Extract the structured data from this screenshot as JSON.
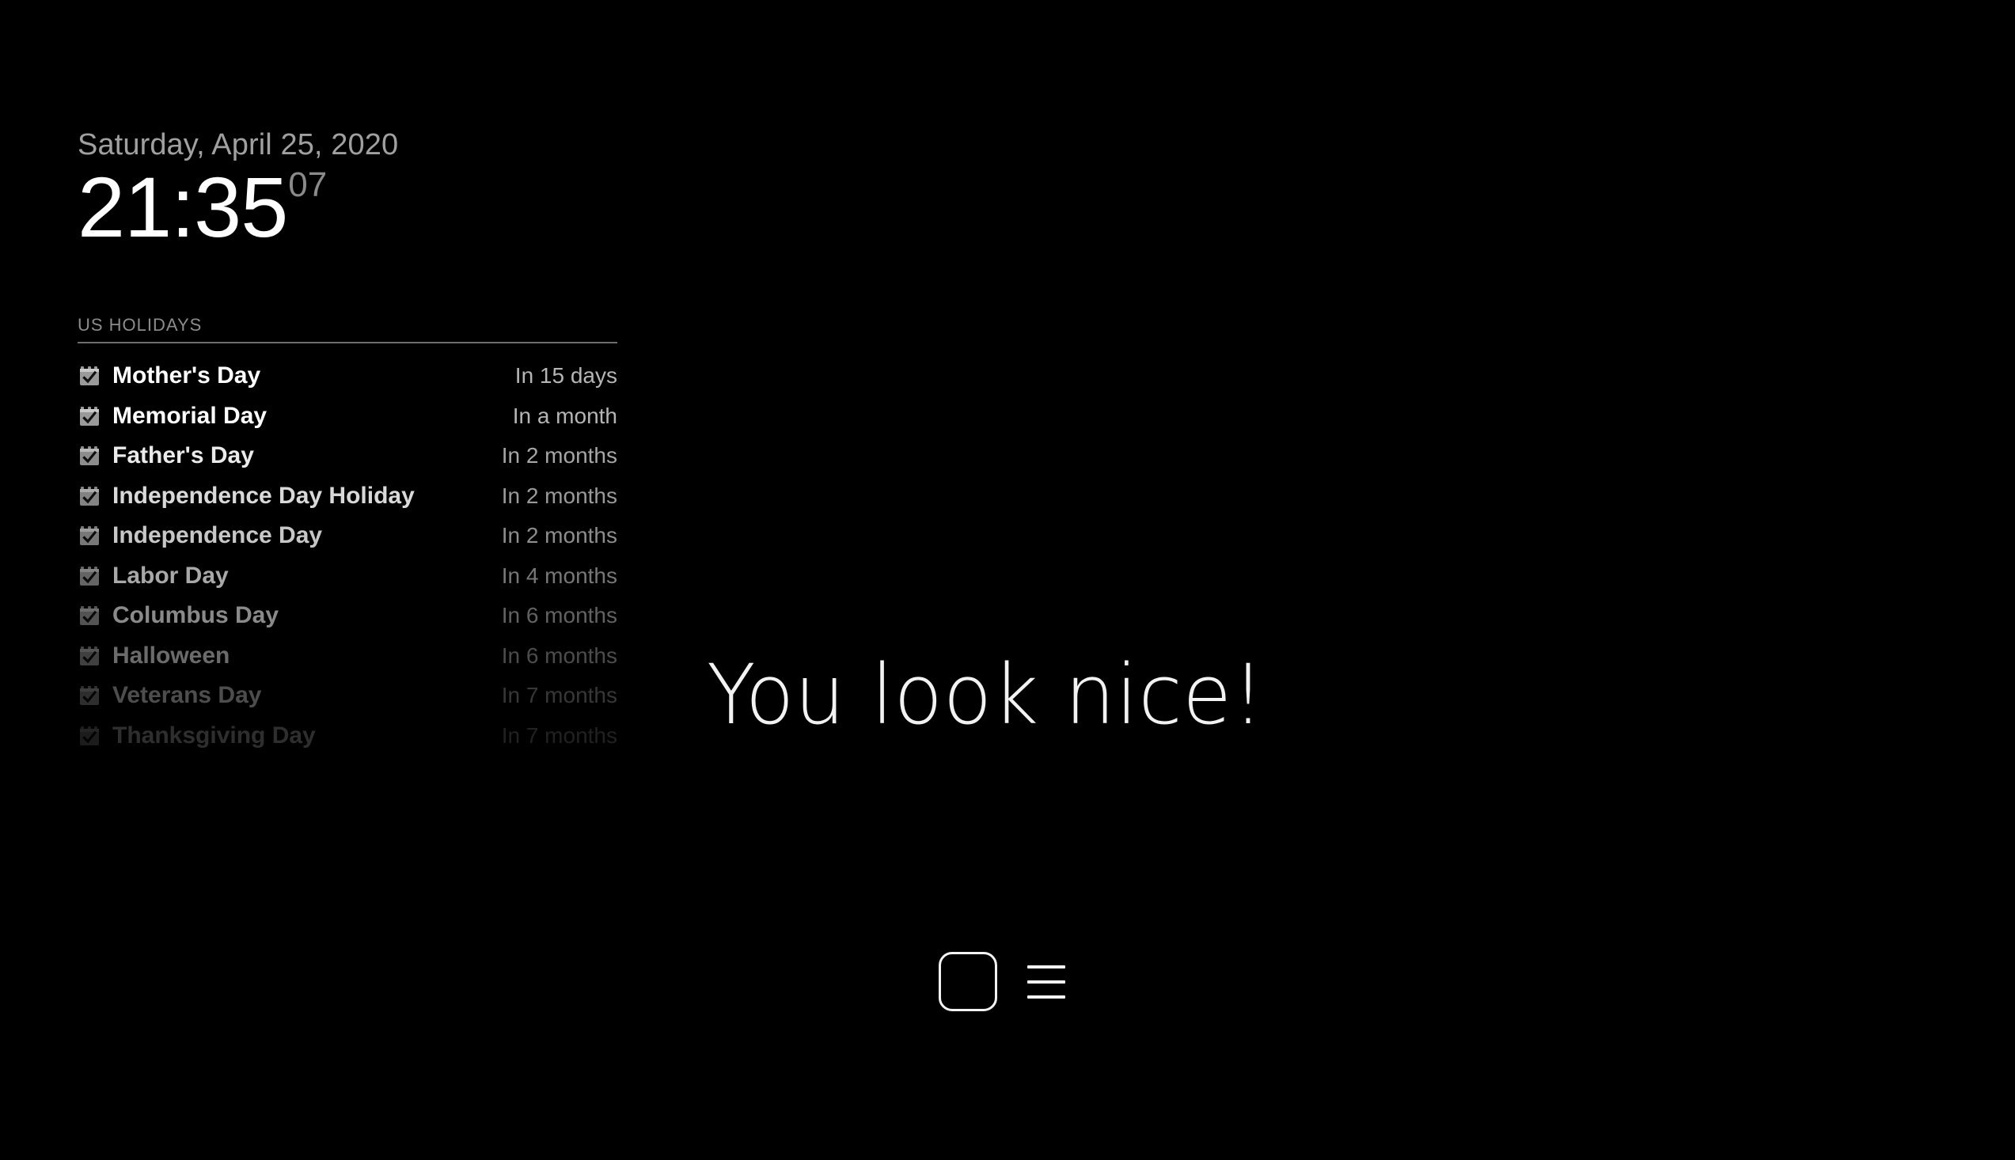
{
  "theme": {
    "background": "#000000",
    "primary_text": "#ffffff",
    "secondary_text": "#a0a0a0",
    "divider": "#6e6e6e",
    "icon": "#9a9a9a"
  },
  "clock": {
    "date": "Saturday, April 25, 2020",
    "time": "21:35",
    "seconds": "07"
  },
  "agenda": {
    "title": "US Holidays",
    "icon_name": "calendar-check-icon",
    "rows": [
      {
        "label": "Mother's Day",
        "relative": "In 15 days"
      },
      {
        "label": "Memorial Day",
        "relative": "In a month"
      },
      {
        "label": "Father's Day",
        "relative": "In 2 months"
      },
      {
        "label": "Independence Day Holiday",
        "relative": "In 2 months"
      },
      {
        "label": "Independence Day",
        "relative": "In 2 months"
      },
      {
        "label": "Labor Day",
        "relative": "In 4 months"
      },
      {
        "label": "Columbus Day",
        "relative": "In 6 months"
      },
      {
        "label": "Halloween",
        "relative": "In 6 months"
      },
      {
        "label": "Veterans Day",
        "relative": "In 7 months"
      },
      {
        "label": "Thanksgiving Day",
        "relative": "In 7 months"
      }
    ]
  },
  "greeting": {
    "message": "You look nice!"
  },
  "navbar": {
    "square_icon_name": "rounded-square-icon",
    "menu_icon_name": "hamburger-menu-icon"
  }
}
